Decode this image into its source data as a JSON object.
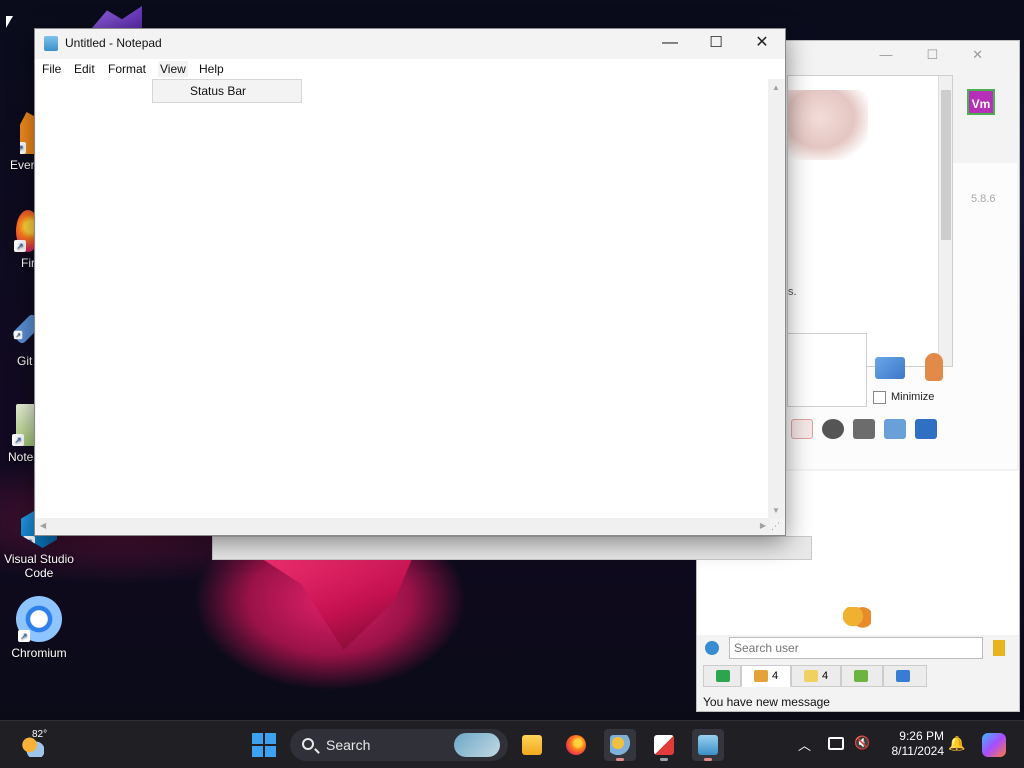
{
  "desktop": {
    "icons": [
      {
        "label": "Ever",
        "icon": "evernote-icon"
      },
      {
        "label": "Fir",
        "icon": "firefox-icon"
      },
      {
        "label": "Git",
        "icon": "git-icon"
      },
      {
        "label": "Note",
        "icon": "notepadpp-icon"
      },
      {
        "label": "Visual Studio Code",
        "icon": "vscode-icon"
      },
      {
        "label": "Chromium",
        "icon": "chromium-icon"
      }
    ]
  },
  "notepad": {
    "title": "Untitled - Notepad",
    "menu": [
      "File",
      "Edit",
      "Format",
      "View",
      "Help"
    ],
    "open_menu": "View",
    "dropdown_items": [
      "Status Bar"
    ],
    "controls": {
      "minimize": "—",
      "maximize": "☐",
      "close": "✕"
    },
    "content": ""
  },
  "chat_app": {
    "version": "5.8.6",
    "vm_badge": "Vm",
    "partial_text": "s.",
    "minimize_label": "Minimize",
    "search_placeholder": "Search user",
    "tabs": [
      {
        "icon": "green-screen-icon",
        "count": ""
      },
      {
        "icon": "users-online-icon",
        "count": "4"
      },
      {
        "icon": "folder-users-icon",
        "count": "4"
      },
      {
        "icon": "network-users-icon",
        "count": ""
      },
      {
        "icon": "blue-flag-icon",
        "count": ""
      }
    ],
    "status_message": "You have new message"
  },
  "taskbar": {
    "weather": "82°",
    "search_label": "Search",
    "apps": [
      "file-explorer",
      "firefox",
      "chat-app",
      "snipping-tool",
      "notepad"
    ],
    "active_app": "notepad",
    "time": "9:26 PM",
    "date": "8/11/2024"
  },
  "colors": {
    "taskbar": "#1f1f24",
    "accent": "#3da0f0",
    "vm_badge": "#b52fb8"
  }
}
